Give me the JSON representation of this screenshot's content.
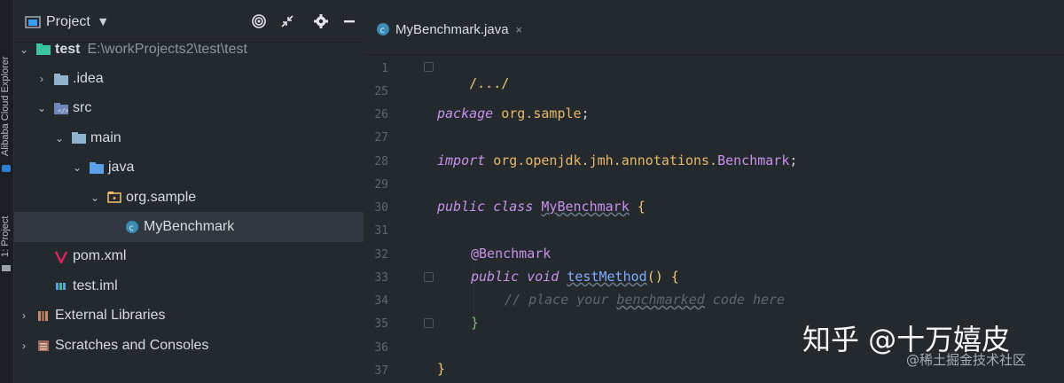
{
  "sidebar_strip": {
    "tabs": [
      {
        "label": "Alibaba Cloud Explorer"
      },
      {
        "label": "1: Project"
      }
    ]
  },
  "project_panel": {
    "title": "Project",
    "dropdown_icon": "triangle-down",
    "header_buttons": [
      "target-icon",
      "collapse-icon",
      "gear-icon",
      "minimize-icon"
    ],
    "tree": [
      {
        "label": "test",
        "path": "E:\\workProjects2\\test\\test",
        "icon": "module-folder-icon",
        "expanded": true,
        "depth": 0
      },
      {
        "label": ".idea",
        "icon": "folder-icon",
        "expanded": false,
        "depth": 1
      },
      {
        "label": "src",
        "icon": "source-folder-icon",
        "expanded": true,
        "depth": 1
      },
      {
        "label": "main",
        "icon": "folder-icon",
        "expanded": true,
        "depth": 2
      },
      {
        "label": "java",
        "icon": "source-root-icon",
        "expanded": true,
        "depth": 3
      },
      {
        "label": "org.sample",
        "icon": "package-icon",
        "expanded": true,
        "depth": 4
      },
      {
        "label": "MyBenchmark",
        "icon": "class-icon",
        "depth": 5,
        "selected": true
      },
      {
        "label": "pom.xml",
        "icon": "maven-icon",
        "depth": 1
      },
      {
        "label": "test.iml",
        "icon": "iml-icon",
        "depth": 1
      },
      {
        "label": "External Libraries",
        "icon": "libraries-icon",
        "expanded": false,
        "depth": 0
      },
      {
        "label": "Scratches and Consoles",
        "icon": "scratches-icon",
        "expanded": false,
        "depth": 0
      }
    ]
  },
  "editor": {
    "tab": {
      "label": "MyBenchmark.java",
      "close": "×"
    },
    "lines": [
      {
        "number": "1",
        "text": "/.../"
      },
      {
        "number": "25",
        "text": ""
      },
      {
        "number": "26",
        "kw": "package",
        "rest": "org.sample",
        "end": ";"
      },
      {
        "number": "27",
        "text": ""
      },
      {
        "number": "28",
        "kw": "import",
        "rest": "org.openjdk.jmh.annotations.",
        "cls": "Benchmark",
        "end": ";"
      },
      {
        "number": "29",
        "text": ""
      },
      {
        "number": "30",
        "kw": "public class",
        "cls": "MyBenchmark",
        "end": "{"
      },
      {
        "number": "31",
        "text": ""
      },
      {
        "number": "32",
        "ann": "@Benchmark"
      },
      {
        "number": "33",
        "kw": "public void",
        "fn": "testMethod",
        "end": "() {"
      },
      {
        "number": "34",
        "comment_a": "// place your ",
        "comment_b": "benchmarked",
        "comment_c": " code here"
      },
      {
        "number": "35",
        "end": "}"
      },
      {
        "number": "36",
        "text": ""
      },
      {
        "number": "37",
        "end": "}"
      }
    ]
  },
  "watermark": {
    "line1": "知乎 @十万嬉皮",
    "line2": "@稀土掘金技术社区"
  },
  "colors": {
    "background": "#24292e",
    "keyword": "#c792ea",
    "package": "#e6b86a",
    "function": "#82aaff",
    "comment": "#5c6670",
    "selected_row": "#323840"
  }
}
